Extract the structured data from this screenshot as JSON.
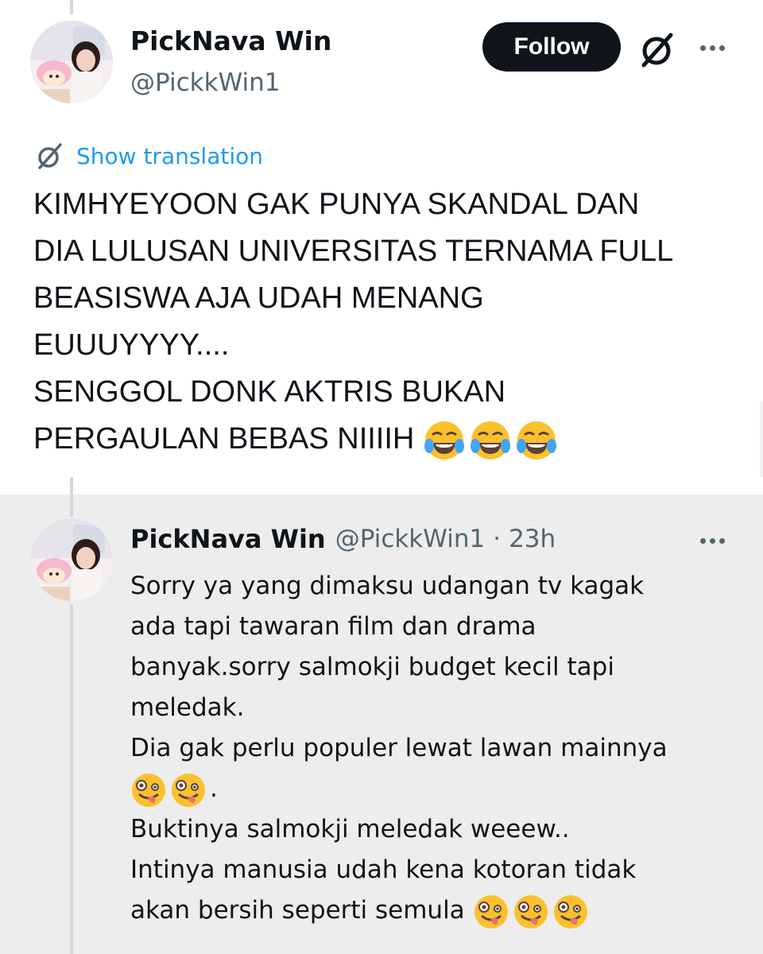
{
  "main_tweet": {
    "author_name": "PickNava Win",
    "author_handle": "@PickkWin1",
    "follow_label": "Follow",
    "translate_label": "Show translation",
    "body_lines": [
      "KIMHYEYOON GAK PUNYA SKANDAL DAN",
      "DIA LULUSAN UNIVERSITAS TERNAMA FULL",
      "BEASISWA AJA UDAH MENANG",
      "EUUUYYYY....",
      "SENGGOL DONK AKTRIS BUKAN",
      "PERGAULAN BEBAS NIIIIH"
    ],
    "body_trailing_emoji": [
      "face-with-tears-of-joy",
      "face-with-tears-of-joy",
      "face-with-tears-of-joy"
    ]
  },
  "reply_tweet": {
    "author_name": "PickNava Win",
    "author_handle": "@PickkWin1",
    "separator": "·",
    "time": "23h",
    "body_lines": [
      "Sorry ya yang dimaksu udangan tv kagak",
      "ada tapi tawaran film dan drama",
      "banyak.sorry salmokji budget kecil tapi",
      "meledak.",
      "Dia gak perlu populer lewat lawan mainnya",
      ".",
      "Buktinya salmokji meledak weeew..",
      "Intinya manusia udah kena kotoran tidak",
      "akan bersih seperti semula"
    ],
    "emoji_line_6": [
      "zany-face",
      "zany-face"
    ],
    "emoji_line_9": [
      "zany-face",
      "zany-face",
      "zany-face"
    ]
  },
  "colors": {
    "follow_bg": "#0f1419",
    "link_blue": "#1d9bf0",
    "secondary_text": "#536471",
    "reply_bg": "#ededed",
    "thread_line": "#cfd9de"
  }
}
